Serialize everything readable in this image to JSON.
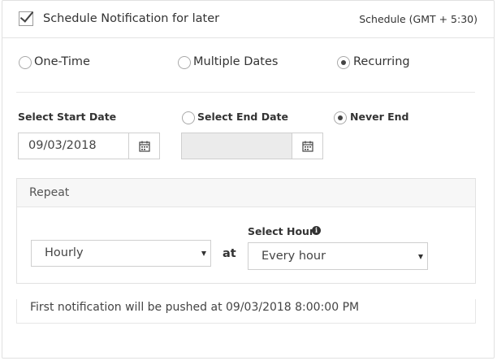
{
  "header": {
    "title": "Schedule Notification for later",
    "timezone": "Schedule (GMT + 5:30)",
    "checked": true
  },
  "schedule_types": [
    {
      "label": "One-Time",
      "selected": false
    },
    {
      "label": "Multiple Dates",
      "selected": false
    },
    {
      "label": "Recurring",
      "selected": true
    }
  ],
  "start_date": {
    "label": "Select Start Date",
    "value": "09/03/2018"
  },
  "end_date": {
    "label": "Select End Date",
    "value": "",
    "selected": false
  },
  "never_end": {
    "label": "Never End",
    "selected": true
  },
  "repeat": {
    "title": "Repeat",
    "frequency": "Hourly",
    "at_label": "at",
    "hour_label": "Select Hour",
    "hour_value": "Every hour"
  },
  "footer": {
    "message": "First notification will be pushed at 09/03/2018 8:00:00 PM"
  }
}
